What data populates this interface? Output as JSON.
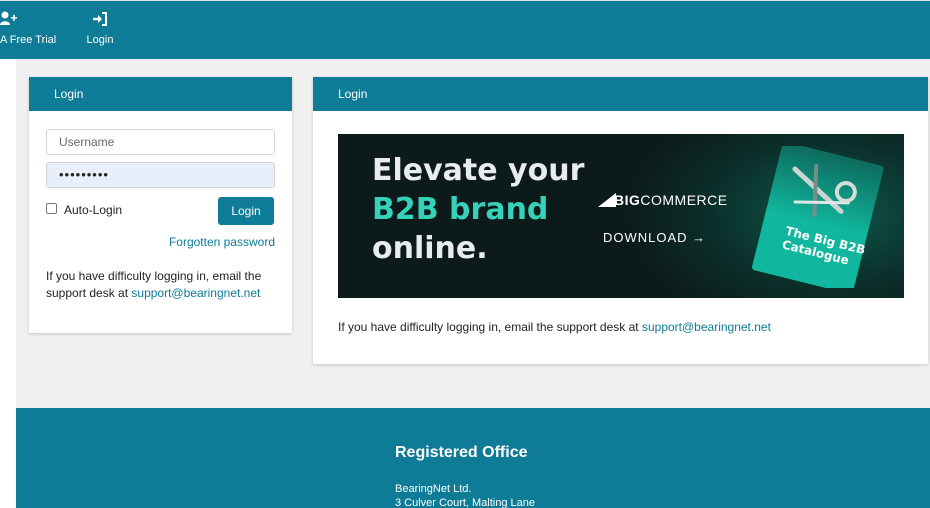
{
  "nav": {
    "trial_label": "A Free Trial",
    "login_label": "Login"
  },
  "login_panel": {
    "title": "Login",
    "username_placeholder": "Username",
    "password_value": "•••••••••",
    "auto_login_label": "Auto-Login",
    "auto_login_checked": false,
    "login_button": "Login",
    "forgot_link": "Forgotten password",
    "help_text": "If you have difficulty logging in, email the support desk at",
    "help_email": "support@bearingnet.net"
  },
  "main_panel": {
    "title": "Login",
    "banner": {
      "line1": "Elevate your",
      "line2": "B2B brand",
      "line3": "online.",
      "brand_big": "BIG",
      "brand_commerce": "COMMERCE",
      "download": "DOWNLOAD →",
      "book_title_1": "The Big B2B",
      "book_title_2": "Catalogue"
    },
    "help_text": "If you have difficulty logging in, email the support desk at",
    "help_email": "support@bearingnet.net"
  },
  "footer": {
    "title": "Registered Office",
    "line1": "BearingNet Ltd.",
    "line2": "3 Culver Court, Malting Lane"
  },
  "colors": {
    "brand": "#0e7b97",
    "accent_green": "#36d1b9"
  }
}
